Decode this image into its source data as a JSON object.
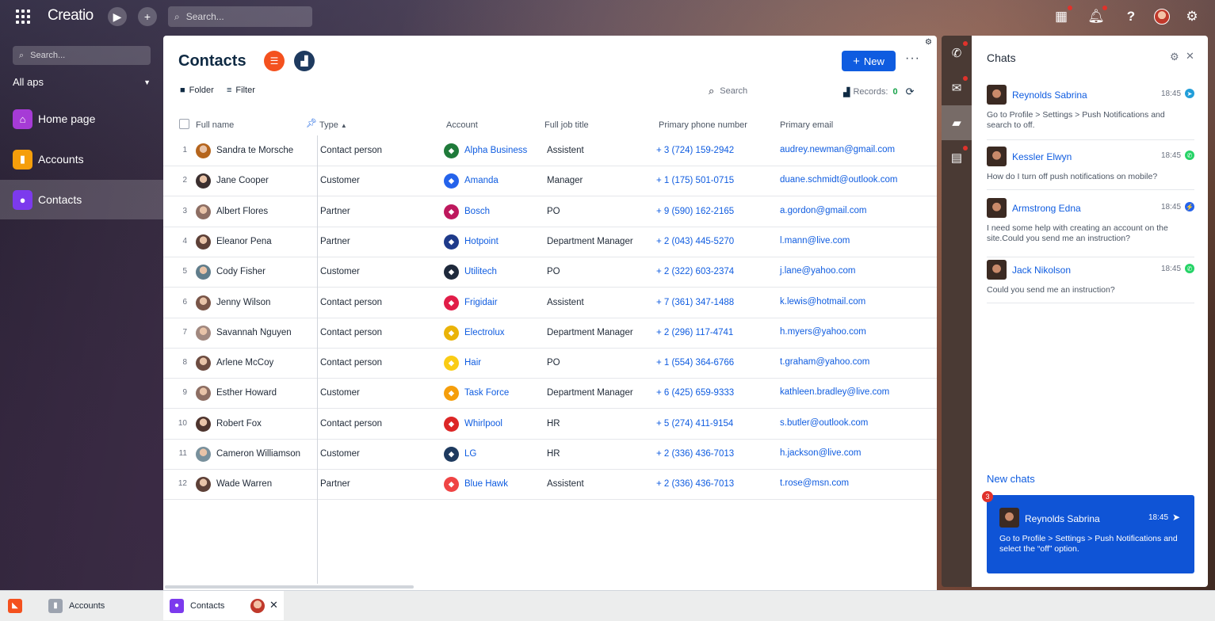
{
  "app": {
    "logo": "Creatio",
    "search_placeholder": "Search..."
  },
  "sidebar": {
    "search_placeholder": "Search...",
    "workplace": "All aps",
    "items": [
      {
        "label": "Home page",
        "color": "#a63bd6",
        "icon": "home-icon"
      },
      {
        "label": "Accounts",
        "color": "#f59e0b",
        "icon": "building-icon"
      },
      {
        "label": "Contacts",
        "color": "#7c3aed",
        "icon": "person-icon"
      }
    ]
  },
  "page": {
    "title": "Contacts",
    "new_label": "New",
    "folder_label": "Folder",
    "filter_label": "Filter",
    "search_placeholder": "Search",
    "records_label": "Records:",
    "records_count": "0"
  },
  "grid": {
    "columns": [
      "Full name",
      "Type",
      "Account",
      "Full job title",
      "Primary phone number",
      "Primary email"
    ],
    "rows": [
      {
        "n": "1",
        "name": "Sandra te Morsche",
        "type": "Contact person",
        "account": "Alpha Business",
        "acc_color": "#1f7a3a",
        "job": "Assistent",
        "phone": "+ 3 (724) 159-2942",
        "email": "audrey.newman@gmail.com"
      },
      {
        "n": "2",
        "name": "Jane Cooper",
        "type": "Customer",
        "account": "Amanda",
        "acc_color": "#2563eb",
        "job": "Manager",
        "phone": "+ 1 (175) 501-0715",
        "email": "duane.schmidt@outlook.com"
      },
      {
        "n": "3",
        "name": "Albert Flores",
        "type": "Partner",
        "account": "Bosch",
        "acc_color": "#be185d",
        "job": "PO",
        "phone": "+ 9 (590) 162-2165",
        "email": "a.gordon@gmail.com"
      },
      {
        "n": "4",
        "name": "Eleanor Pena",
        "type": "Partner",
        "account": "Hotpoint",
        "acc_color": "#1e3a8a",
        "job": "Department Manager",
        "phone": "+ 2 (043) 445-5270",
        "email": "l.mann@live.com"
      },
      {
        "n": "5",
        "name": "Cody Fisher",
        "type": "Customer",
        "account": "Utilitech",
        "acc_color": "#1e293b",
        "job": "PO",
        "phone": "+ 2 (322) 603-2374",
        "email": "j.lane@yahoo.com"
      },
      {
        "n": "6",
        "name": "Jenny Wilson",
        "type": "Contact person",
        "account": "Frigidair",
        "acc_color": "#e11d48",
        "job": "Assistent",
        "phone": "+ 7 (361) 347-1488",
        "email": "k.lewis@hotmail.com"
      },
      {
        "n": "7",
        "name": "Savannah Nguyen",
        "type": "Contact person",
        "account": "Electrolux",
        "acc_color": "#eab308",
        "job": "Department Manager",
        "phone": "+ 2 (296) 117-4741",
        "email": "h.myers@yahoo.com"
      },
      {
        "n": "8",
        "name": "Arlene McCoy",
        "type": "Contact person",
        "account": "Hair",
        "acc_color": "#facc15",
        "job": "PO",
        "phone": "+ 1 (554) 364-6766",
        "email": "t.graham@yahoo.com"
      },
      {
        "n": "9",
        "name": "Esther Howard",
        "type": "Customer",
        "account": "Task Force",
        "acc_color": "#f59e0b",
        "job": "Department Manager",
        "phone": "+ 6 (425) 659-9333",
        "email": "kathleen.bradley@live.com"
      },
      {
        "n": "10",
        "name": "Robert Fox",
        "type": "Contact person",
        "account": "Whirlpool",
        "acc_color": "#dc2626",
        "job": "HR",
        "phone": "+ 5 (274) 411-9154",
        "email": "s.butler@outlook.com"
      },
      {
        "n": "11",
        "name": "Cameron Williamson",
        "type": "Customer",
        "account": "LG",
        "acc_color": "#1e3a5f",
        "job": "HR",
        "phone": "+ 2 (336) 436-7013",
        "email": "h.jackson@live.com"
      },
      {
        "n": "12",
        "name": "Wade Warren",
        "type": "Partner",
        "account": "Blue Hawk",
        "acc_color": "#ef4444",
        "job": "Assistent",
        "phone": "+ 2 (336) 436-7013",
        "email": "t.rose@msn.com"
      }
    ]
  },
  "chats": {
    "title": "Chats",
    "items": [
      {
        "name": "Reynolds Sabrina",
        "time": "18:45",
        "channel": "telegram-icon",
        "channel_color": "#229ed9",
        "message": "Go to Profile > Settings > Push Notifications and search to off."
      },
      {
        "name": "Kessler Elwyn",
        "time": "18:45",
        "channel": "whatsapp-icon",
        "channel_color": "#25d366",
        "message": "How do I turn off push notifications on mobile?"
      },
      {
        "name": "Armstrong Edna",
        "time": "18:45",
        "channel": "messenger-icon",
        "channel_color": "#2563eb",
        "message": "I need some help with creating an account on the site.Could you send me an instruction?"
      },
      {
        "name": "Jack Nikolson",
        "time": "18:45",
        "channel": "whatsapp-icon",
        "channel_color": "#25d366",
        "message": "Could you send me an instruction?"
      }
    ],
    "new_chats_title": "New chats",
    "new_chat": {
      "badge": "3",
      "name": "Reynolds Sabrina",
      "time": "18:45",
      "message": "Go to Profile > Settings > Push Notifications and select the “off” option."
    }
  },
  "taskbar": {
    "tabs": [
      {
        "label": "Accounts"
      },
      {
        "label": "Contacts"
      }
    ]
  }
}
